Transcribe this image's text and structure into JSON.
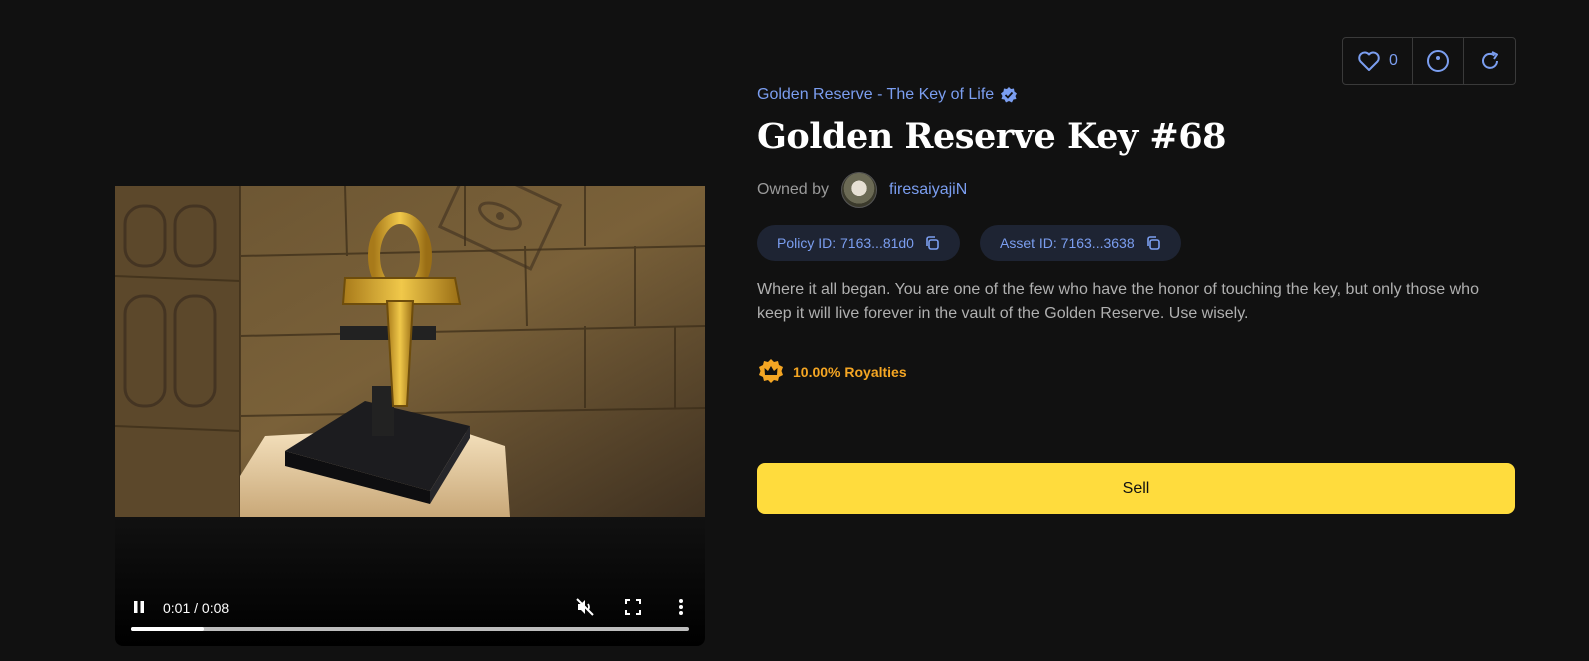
{
  "video": {
    "time_display": "0:01 / 0:08",
    "progress_fraction": 0.13,
    "icons": {
      "play": "pause-icon",
      "mute": "muted-speaker-icon",
      "fullscreen": "fullscreen-icon",
      "more": "more-vert-icon"
    }
  },
  "actions": {
    "like_count": "0",
    "icons": [
      "heart-icon",
      "circle-dot-icon",
      "refresh-icon"
    ]
  },
  "collection": {
    "name": "Golden Reserve - The Key of Life",
    "verified": true
  },
  "asset": {
    "title": "Golden Reserve Key #68",
    "owned_by_label": "Owned by",
    "owner": "firesaiyajiN",
    "policy_id": "Policy ID: 7163...81d0",
    "asset_id": "Asset ID: 7163...3638",
    "description": "Where it all began. You are one of the few who have the honor of touching the key, but only those who keep it will live forever in the vault of the Golden Reserve. Use wisely.",
    "royalties": "10.00% Royalties"
  },
  "sell_label": "Sell",
  "colors": {
    "accent": "#7b9ef0",
    "sell_button": "#ffdc3d",
    "royalty": "#f5a623",
    "background": "#111111",
    "chip_bg": "#1e2433"
  }
}
